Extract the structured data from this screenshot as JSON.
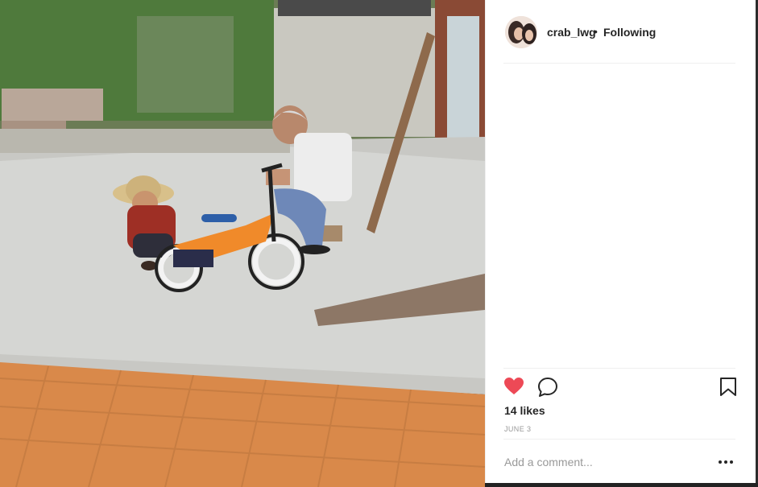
{
  "post": {
    "username": "crab_lwg",
    "separator": "•",
    "follow_status": "Following",
    "likes_text": "14 likes",
    "date_text": "JUNE 3",
    "comment_placeholder": "Add a comment..."
  },
  "icons": {
    "like": "heart-icon",
    "comment": "comment-bubble-icon",
    "save": "bookmark-icon",
    "more": "more-options-icon"
  },
  "colors": {
    "like_active": "#ed4956",
    "text": "#262626",
    "muted": "#999999",
    "border": "#efefef"
  }
}
